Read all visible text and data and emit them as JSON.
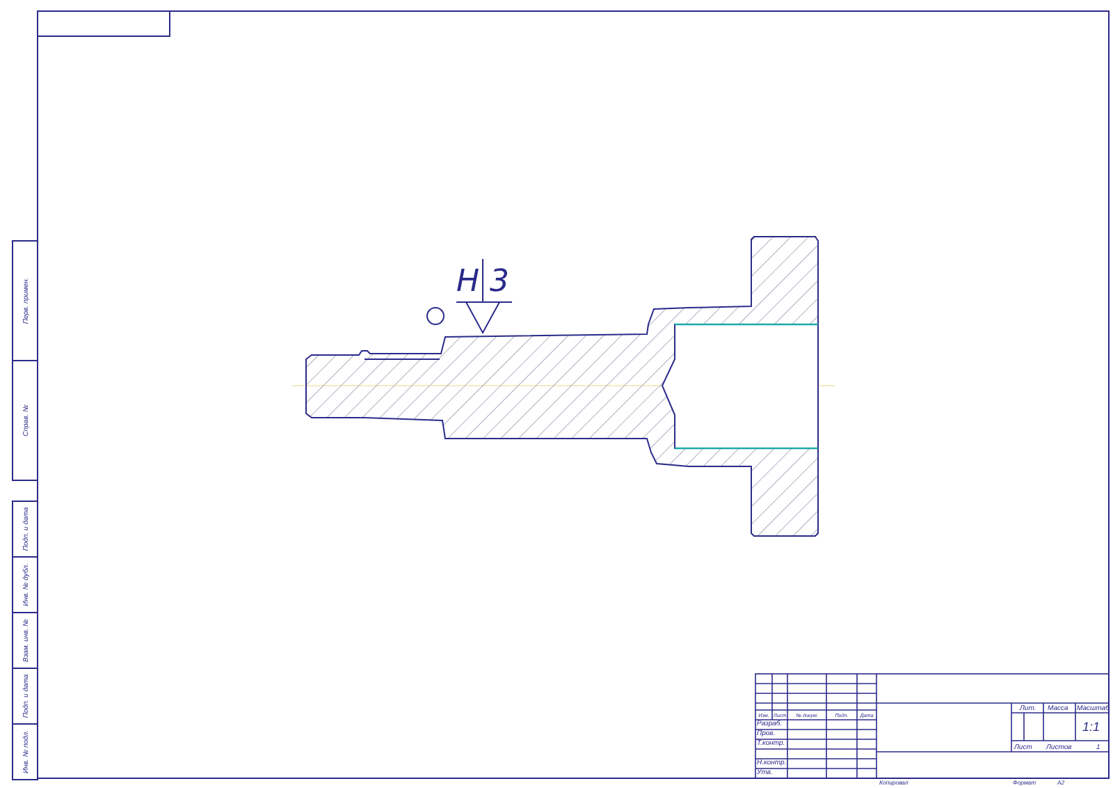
{
  "roughness_mark": {
    "symbol": "H",
    "value": "3"
  },
  "side_stamps_upper": [
    "Перв. примен.",
    "Справ. №"
  ],
  "side_stamps_lower": [
    "Подп. и дата",
    "Инв. № дубл.",
    "Взам. инв. №",
    "Подп. и дата",
    "Инв. № подл."
  ],
  "title_block": {
    "header": [
      "Изм.",
      "Лист",
      "№ докум.",
      "Подп.",
      "Дата"
    ],
    "roles": [
      "Разраб.",
      "Пров.",
      "Т.контр.",
      "Н.контр.",
      "Утв."
    ],
    "lit_label": "Лит.",
    "mass_label": "Масса",
    "scale_label": "Масштаб",
    "scale": "1:1",
    "sheet_label": "Лист",
    "sheets_label": "Листов",
    "sheets": "1"
  },
  "footer": {
    "copied": "Копировал",
    "format_label": "Формат",
    "format": "A2"
  }
}
